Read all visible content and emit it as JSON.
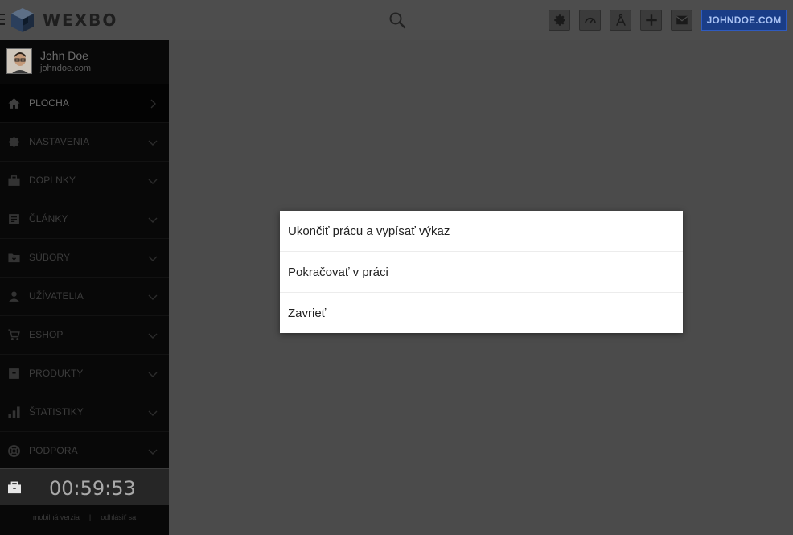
{
  "header": {
    "logo_text": "WEXBO",
    "domain_button": "JOHNDOE.COM",
    "tools": [
      {
        "icon": "gear-icon"
      },
      {
        "icon": "speedometer-icon"
      },
      {
        "icon": "compass-icon"
      },
      {
        "icon": "plus-icon"
      },
      {
        "icon": "mail-icon"
      }
    ]
  },
  "profile": {
    "name": "John Doe",
    "site": "johndoe.com"
  },
  "sidebar": {
    "items": [
      {
        "label": "PLOCHA",
        "icon": "home-icon"
      },
      {
        "label": "NASTAVENIA",
        "icon": "gear-icon"
      },
      {
        "label": "DOPLNKY",
        "icon": "briefcase-icon"
      },
      {
        "label": "ČLÁNKY",
        "icon": "article-icon"
      },
      {
        "label": "SÚBORY",
        "icon": "file-download-icon"
      },
      {
        "label": "UŽÍVATELIA",
        "icon": "person-icon"
      },
      {
        "label": "ESHOP",
        "icon": "cart-icon"
      },
      {
        "label": "PRODUKTY",
        "icon": "box-icon"
      },
      {
        "label": "ŠTATISTIKY",
        "icon": "bar-chart-icon"
      },
      {
        "label": "PODPORA",
        "icon": "lifebuoy-icon"
      }
    ],
    "timer": "00:59:53",
    "footer": {
      "mobile": "mobilná verzia",
      "separator": "|",
      "logout": "odhlásiť sa"
    }
  },
  "modal": {
    "items": [
      "Ukončiť prácu a vypísať výkaz",
      "Pokračovať v práci",
      "Zavrieť"
    ]
  },
  "colors": {
    "background": "#4b4b4b",
    "sidebar": "#080808",
    "accent": "#1a3d87",
    "modal": "#ffffff"
  }
}
